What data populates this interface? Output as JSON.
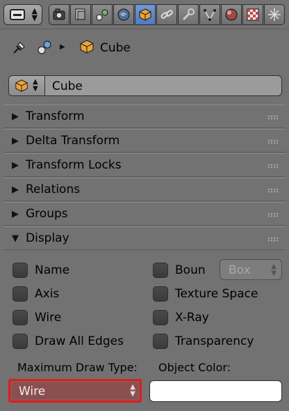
{
  "breadcrumb": {
    "object_label": "Cube"
  },
  "object_name_field": {
    "value": "Cube"
  },
  "panels": {
    "transform": "Transform",
    "delta_transform": "Delta Transform",
    "transform_locks": "Transform Locks",
    "relations": "Relations",
    "groups": "Groups",
    "display": "Display"
  },
  "display": {
    "name": "Name",
    "axis": "Axis",
    "wire": "Wire",
    "draw_all_edges": "Draw All Edges",
    "bounds": "Boun",
    "bounds_type": "Box",
    "texture_space": "Texture Space",
    "xray": "X-Ray",
    "transparency": "Transparency",
    "max_draw_type_label": "Maximum Draw Type:",
    "max_draw_type_value": "Wire",
    "object_color_label": "Object Color:",
    "object_color": "#ffffff"
  },
  "colors": {
    "background": "#727272",
    "active_tab": "#5c86cf",
    "highlight_border": "#e01c1c",
    "object_orange": "#e8a33c"
  },
  "icons": {
    "context_menu": "properties-editor-icon",
    "tabs": [
      "render-icon",
      "render-layers-icon",
      "scene-icon",
      "world-icon",
      "object-icon",
      "constraints-icon",
      "modifiers-icon",
      "data-icon",
      "material-icon",
      "texture-icon",
      "particles-icon"
    ]
  }
}
